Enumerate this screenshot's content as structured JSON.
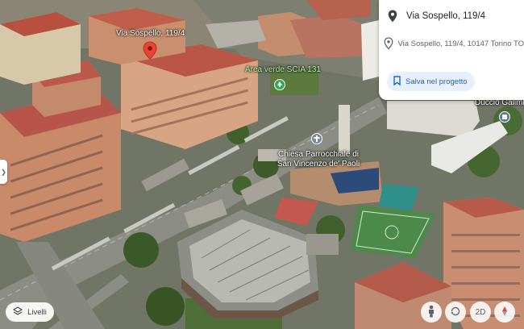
{
  "map": {
    "labels": {
      "street_address": "Via Sospello, 119/4",
      "park": "Area verde SCIA 131",
      "church": "Chiesa Parrocchiale di San Vincenzo de' Paoli",
      "business": "Duccio Galimb"
    },
    "colors": {
      "pin_red": "#ea4335",
      "park_green": "#34a853",
      "label_green": "#b8f5a8"
    }
  },
  "panel": {
    "title": "Via Sospello, 119/4",
    "address": "Via Sospello, 119/4, 10147 Torino TO",
    "save_label": "Salva nel progetto",
    "icons": {
      "title": "location-pin-icon",
      "address": "map-pin-outline-icon",
      "save": "bookmark-icon"
    },
    "accent": "#1967d2"
  },
  "controls": {
    "layers_label": "Livelli",
    "mode_label": "2D",
    "icons": [
      "pegman-icon",
      "rotate-icon",
      "compass-icon"
    ]
  }
}
